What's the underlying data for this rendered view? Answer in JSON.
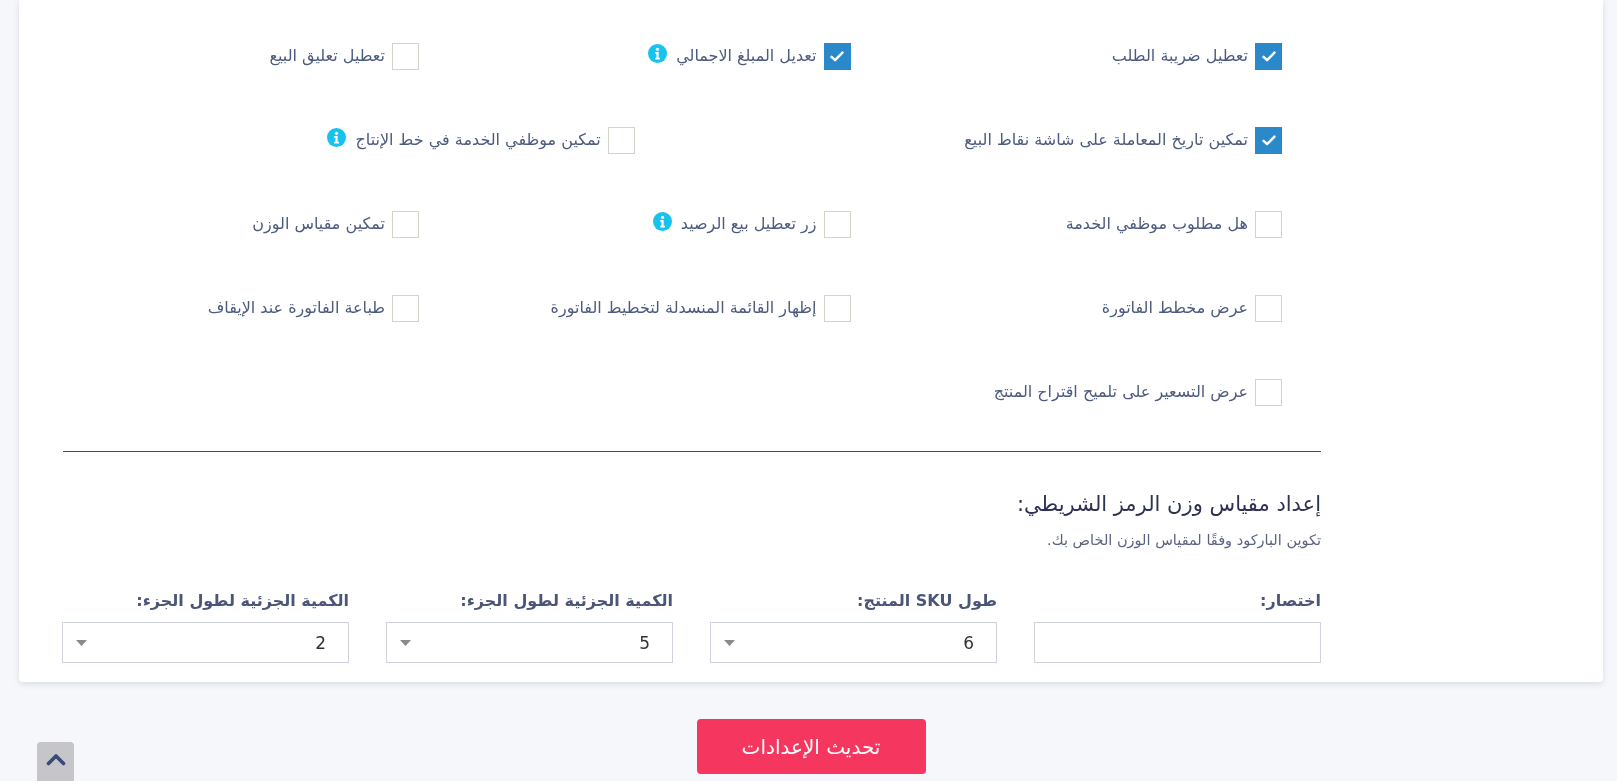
{
  "checkbox_rows": [
    [
      {
        "label": "تعطيل ضريبة الطلب",
        "checked": true,
        "info": false
      },
      {
        "label": "تعديل المبلغ الاجمالي",
        "checked": true,
        "info": true
      },
      {
        "label": "تعطيل تعليق البيع",
        "checked": false,
        "info": false
      }
    ],
    [
      {
        "label": "تمكين تاريخ المعاملة على شاشة نقاط البيع",
        "checked": true,
        "info": false
      },
      {
        "label": "تمكين موظفي الخدمة في خط الإنتاج",
        "checked": false,
        "info": true
      }
    ],
    [
      {
        "label": "هل مطلوب موظفي الخدمة",
        "checked": false,
        "info": false
      },
      {
        "label": "زر تعطيل بيع الرصيد",
        "checked": false,
        "info": true
      },
      {
        "label": "تمكين مقياس الوزن",
        "checked": false,
        "info": false
      }
    ],
    [
      {
        "label": "عرض مخطط الفاتورة",
        "checked": false,
        "info": false
      },
      {
        "label": "إظهار القائمة المنسدلة لتخطيط الفاتورة",
        "checked": false,
        "info": false
      },
      {
        "label": "طباعة الفاتورة عند الإيقاف",
        "checked": false,
        "info": false
      }
    ],
    [
      {
        "label": "عرض التسعير على تلميح اقتراح المنتج",
        "checked": false,
        "info": false
      }
    ]
  ],
  "barcode_section": {
    "title": "إعداد مقياس وزن الرمز الشريطي:",
    "description": "تكوين الباركود وفقًا لمقياس الوزن الخاص بك.",
    "fields": [
      {
        "kind": "input",
        "label": "اختصار:"
      },
      {
        "kind": "select",
        "label": "طول SKU المنتج:",
        "value": "6"
      },
      {
        "kind": "select",
        "label": "الكمية الجزئية لطول الجزء:",
        "value": "5"
      },
      {
        "kind": "select",
        "label": "الكمية الجزئية لطول الجزء:",
        "value": "2"
      }
    ]
  },
  "update_button": {
    "label": "تحديث الإعدادات"
  }
}
